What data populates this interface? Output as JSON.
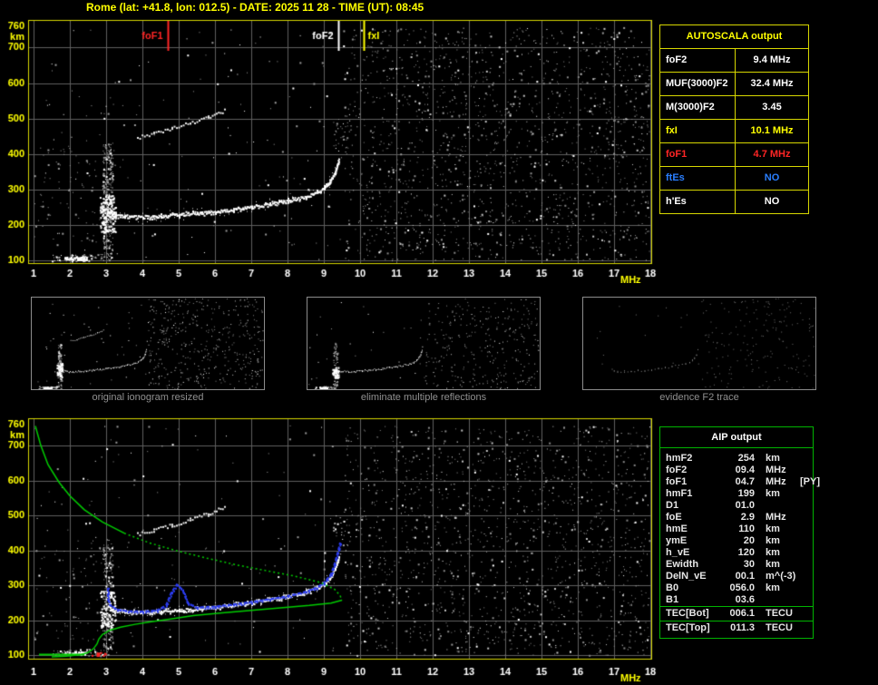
{
  "header": {
    "title": "Rome (lat: +41.8, lon: 012.5) - DATE: 2025 11 28 - TIME (UT): 08:45"
  },
  "autoscala": {
    "title": "AUTOSCALA output",
    "rows": [
      {
        "label": "foF2",
        "value": "9.4 MHz",
        "color": "#ffffff"
      },
      {
        "label": "MUF(3000)F2",
        "value": "32.4 MHz",
        "color": "#ffffff"
      },
      {
        "label": "M(3000)F2",
        "value": "3.45",
        "color": "#ffffff"
      },
      {
        "label": "fxI",
        "value": "10.1 MHz",
        "color": "#ffff00"
      },
      {
        "label": "foF1",
        "value": "4.7 MHz",
        "color": "#ff2525"
      },
      {
        "label": "ftEs",
        "value": "NO",
        "color": "#2a7fff"
      },
      {
        "label": "h'Es",
        "value": "NO",
        "color": "#ffffff"
      }
    ]
  },
  "aip": {
    "title": "AIP output",
    "rows": [
      {
        "name": "hmF2",
        "value": "254",
        "unit": "km",
        "extra": "",
        "sep": false
      },
      {
        "name": "foF2",
        "value": "09.4",
        "unit": "MHz",
        "extra": "",
        "sep": false
      },
      {
        "name": "foF1",
        "value": "04.7",
        "unit": "MHz",
        "extra": "[PY]",
        "sep": false
      },
      {
        "name": "hmF1",
        "value": "199",
        "unit": "km",
        "extra": "",
        "sep": false
      },
      {
        "name": "D1",
        "value": "01.0",
        "unit": "",
        "extra": "",
        "sep": false
      },
      {
        "name": "foE",
        "value": "2.9",
        "unit": "MHz",
        "extra": "",
        "sep": false
      },
      {
        "name": "hmE",
        "value": "110",
        "unit": "km",
        "extra": "",
        "sep": false
      },
      {
        "name": "ymE",
        "value": "20",
        "unit": "km",
        "extra": "",
        "sep": false
      },
      {
        "name": "h_vE",
        "value": "120",
        "unit": "km",
        "extra": "",
        "sep": false
      },
      {
        "name": "Ewidth",
        "value": "30",
        "unit": "km",
        "extra": "",
        "sep": false
      },
      {
        "name": "DelN_vE",
        "value": "00.1",
        "unit": "m^(-3)",
        "extra": "",
        "sep": false
      },
      {
        "name": "B0",
        "value": "056.0",
        "unit": "km",
        "extra": "",
        "sep": false
      },
      {
        "name": "B1",
        "value": "03.6",
        "unit": "",
        "extra": "",
        "sep": false
      },
      {
        "name": "TEC[Bot]",
        "value": "006.1",
        "unit": "TECU",
        "extra": "",
        "sep": true
      },
      {
        "name": "TEC[Top]",
        "value": "011.3",
        "unit": "TECU",
        "extra": "",
        "sep": true
      }
    ]
  },
  "thumbnails": [
    {
      "caption": "original ionogram resized"
    },
    {
      "caption": "eliminate multiple reflections"
    },
    {
      "caption": "evidence F2 trace"
    }
  ],
  "colors": {
    "background": "#000000",
    "accent_yellow": "#ffff00",
    "plot_border": "#d8d800",
    "grid": "#5f5f5f",
    "green": "#00cc00",
    "table_green": "#00b400",
    "red": "#ff2525",
    "blue_value": "#2a7fff",
    "trace_blue": "#2b3cf0",
    "white": "#ffffff",
    "caption_gray": "#909090"
  },
  "chart_data": [
    {
      "type": "scatter",
      "name": "autoscaled ionogram with critical frequency markers",
      "xlabel": "MHz",
      "ylabel": "km",
      "xlim": [
        1,
        18
      ],
      "ylim": [
        100,
        760
      ],
      "x_ticks": [
        1,
        2,
        3,
        4,
        5,
        6,
        7,
        8,
        9,
        10,
        11,
        12,
        13,
        14,
        15,
        16,
        17,
        18
      ],
      "y_ticks": [
        760,
        700,
        600,
        500,
        400,
        300,
        200,
        100
      ],
      "grid": true,
      "markers": [
        {
          "label": "foF1",
          "freq": 4.7,
          "color": "#ff2525"
        },
        {
          "label": "foF2",
          "freq": 9.4,
          "color": "#ffffff"
        },
        {
          "label": "fxI",
          "freq": 10.1,
          "color": "#ffff00"
        }
      ],
      "f2_trace": [
        [
          3.1,
          238
        ],
        [
          3.25,
          229
        ],
        [
          3.5,
          225
        ],
        [
          4.0,
          224
        ],
        [
          4.5,
          226
        ],
        [
          5.0,
          230
        ],
        [
          5.5,
          234
        ],
        [
          6.0,
          239
        ],
        [
          6.5,
          245
        ],
        [
          7.0,
          252
        ],
        [
          7.5,
          260
        ],
        [
          8.0,
          269
        ],
        [
          8.5,
          281
        ],
        [
          8.8,
          293
        ],
        [
          9.0,
          306
        ],
        [
          9.15,
          322
        ],
        [
          9.3,
          348
        ],
        [
          9.4,
          382
        ]
      ],
      "multiple_trace": [
        [
          3.85,
          447
        ],
        [
          4.3,
          459
        ],
        [
          4.8,
          473
        ],
        [
          5.3,
          489
        ],
        [
          5.8,
          506
        ],
        [
          6.25,
          524
        ]
      ],
      "e_column": {
        "f_range": [
          2.9,
          3.18
        ],
        "h_range": [
          100,
          432
        ],
        "blob_f": [
          2.82,
          3.25
        ],
        "blob_h": [
          180,
          285
        ]
      },
      "es_cluster": {
        "f_range": [
          1.5,
          2.9
        ],
        "h_range": [
          98,
          118
        ],
        "blob_f": [
          1.85,
          2.45
        ],
        "blob_h": [
          102,
          112
        ]
      },
      "noise": {
        "seed": 1234,
        "sparse_count": 380,
        "left_scatter_count": 90,
        "dense_right_fmin": 9.55,
        "dense_right_count": 1500
      }
    },
    {
      "type": "scatter",
      "name": "ionogram with restored trace (blue) and electron density profile (green)",
      "xlabel": "MHz",
      "ylabel": "km",
      "xlim": [
        1,
        18
      ],
      "ylim": [
        100,
        760
      ],
      "x_ticks": [
        1,
        2,
        3,
        4,
        5,
        6,
        7,
        8,
        9,
        10,
        11,
        12,
        13,
        14,
        15,
        16,
        17,
        18
      ],
      "y_ticks": [
        760,
        700,
        600,
        500,
        400,
        300,
        200,
        100
      ],
      "grid": true,
      "profile_topside": [
        [
          1.05,
          756
        ],
        [
          1.2,
          700
        ],
        [
          1.4,
          645
        ],
        [
          1.7,
          595
        ],
        [
          2.0,
          556
        ],
        [
          2.4,
          516
        ],
        [
          2.9,
          481
        ],
        [
          3.5,
          449
        ],
        [
          4.2,
          421
        ],
        [
          5.0,
          397
        ],
        [
          5.8,
          377
        ],
        [
          6.6,
          358
        ],
        [
          7.4,
          342
        ],
        [
          8.2,
          326
        ],
        [
          8.9,
          308
        ],
        [
          9.3,
          288
        ],
        [
          9.45,
          270
        ],
        [
          9.5,
          257
        ]
      ],
      "profile_bottomside": [
        [
          9.5,
          257
        ],
        [
          9.2,
          249
        ],
        [
          8.6,
          242
        ],
        [
          7.8,
          235
        ],
        [
          7.0,
          228
        ],
        [
          6.2,
          221
        ],
        [
          5.4,
          213
        ],
        [
          4.7,
          202
        ],
        [
          4.2,
          195
        ],
        [
          3.8,
          188
        ],
        [
          3.4,
          180
        ],
        [
          3.1,
          171
        ],
        [
          2.9,
          159
        ],
        [
          2.8,
          146
        ],
        [
          2.75,
          132
        ],
        [
          2.65,
          118
        ],
        [
          2.5,
          107
        ],
        [
          2.3,
          101
        ],
        [
          1.9,
          97
        ],
        [
          1.5,
          95
        ]
      ],
      "profile_solid_until_f": 3.6,
      "restored_trace": [
        [
          3.05,
          292
        ],
        [
          3.05,
          260
        ],
        [
          3.1,
          243
        ],
        [
          3.3,
          230
        ],
        [
          3.6,
          226
        ],
        [
          4.0,
          225
        ],
        [
          4.4,
          228
        ],
        [
          4.65,
          242
        ],
        [
          4.8,
          280
        ],
        [
          4.95,
          302
        ],
        [
          5.1,
          288
        ],
        [
          5.25,
          248
        ],
        [
          5.5,
          236
        ],
        [
          6.0,
          239
        ],
        [
          6.5,
          245
        ],
        [
          7.0,
          252
        ],
        [
          7.5,
          260
        ],
        [
          8.0,
          269
        ],
        [
          8.5,
          281
        ],
        [
          8.8,
          293
        ],
        [
          9.0,
          306
        ],
        [
          9.2,
          332
        ],
        [
          9.3,
          362
        ],
        [
          9.4,
          400
        ],
        [
          9.45,
          422
        ]
      ],
      "base_segment": [
        [
          1.15,
          101
        ],
        [
          2.4,
          101
        ]
      ],
      "red_marks": {
        "f_range": [
          2.55,
          3.0
        ],
        "h_range": [
          99,
          109
        ],
        "count": 14
      },
      "noise": {
        "seed": 777,
        "sparse_count": 330,
        "left_scatter_count": 70,
        "dense_right_fmin": 9.55,
        "dense_right_count": 1350
      }
    }
  ]
}
